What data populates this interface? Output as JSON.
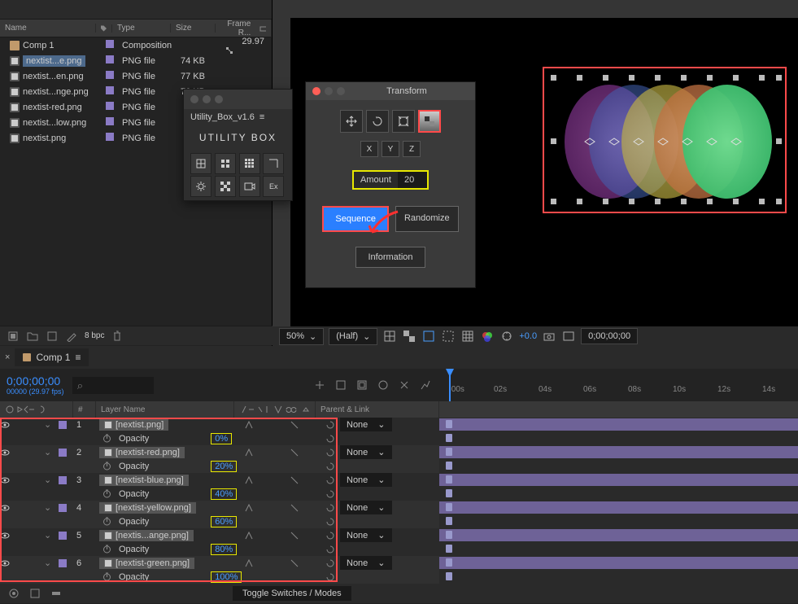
{
  "project_panel": {
    "columns": {
      "name": "Name",
      "type": "Type",
      "size": "Size",
      "frame": "Frame R..."
    },
    "items": [
      {
        "name": "Comp 1",
        "type": "Composition",
        "size": "",
        "frame": "29.97",
        "icon": "composition"
      },
      {
        "name": "nextist...e.png",
        "type": "PNG file",
        "size": "74 KB",
        "frame": "",
        "icon": "png",
        "selected": true
      },
      {
        "name": "nextist...en.png",
        "type": "PNG file",
        "size": "77 KB",
        "frame": "",
        "icon": "png"
      },
      {
        "name": "nextist...nge.png",
        "type": "PNG file",
        "size": "76 KB",
        "frame": "",
        "icon": "png"
      },
      {
        "name": "nextist-red.png",
        "type": "PNG file",
        "size": "",
        "frame": "",
        "icon": "png"
      },
      {
        "name": "nextist...low.png",
        "type": "PNG file",
        "size": "",
        "frame": "",
        "icon": "png"
      },
      {
        "name": "nextist.png",
        "type": "PNG file",
        "size": "",
        "frame": "",
        "icon": "png"
      }
    ],
    "bpc_label": "8 bpc"
  },
  "viewer": {
    "zoom": "50%",
    "resolution": "(Half)",
    "exposure": "+0.0",
    "timecode": "0;00;00;00"
  },
  "utility_panel": {
    "title": "Utility_Box_v1.6",
    "logo": "UTILITY BOX"
  },
  "transform_panel": {
    "title": "Transform",
    "xyz": [
      "X",
      "Y",
      "Z"
    ],
    "amount_label": "Amount",
    "amount_value": "20",
    "sequence_label": "Sequence",
    "randomize_label": "Randomize",
    "information_label": "Information"
  },
  "timeline": {
    "tab_name": "Comp 1",
    "timecode": "0;00;00;00",
    "fps_label": "00000 (29.97 fps)",
    "search_placeholder": "⌕",
    "col_num": "#",
    "col_layer_name": "Layer Name",
    "col_parent": "Parent & Link",
    "ruler": [
      ":00s",
      "02s",
      "04s",
      "06s",
      "08s",
      "10s",
      "12s",
      "14s"
    ],
    "layers": [
      {
        "num": "1",
        "name": "[nextist.png]",
        "opacity": "0%",
        "parent": "None"
      },
      {
        "num": "2",
        "name": "[nextist-red.png]",
        "opacity": "20%",
        "parent": "None"
      },
      {
        "num": "3",
        "name": "[nextist-blue.png]",
        "opacity": "40%",
        "parent": "None"
      },
      {
        "num": "4",
        "name": "[nextist-yellow.png]",
        "opacity": "60%",
        "parent": "None"
      },
      {
        "num": "5",
        "name": "[nextis...ange.png]",
        "opacity": "80%",
        "parent": "None"
      },
      {
        "num": "6",
        "name": "[nextist-green.png]",
        "opacity": "100%",
        "parent": "None"
      }
    ],
    "opacity_label": "Opacity",
    "toggle_switches": "Toggle Switches / Modes"
  }
}
